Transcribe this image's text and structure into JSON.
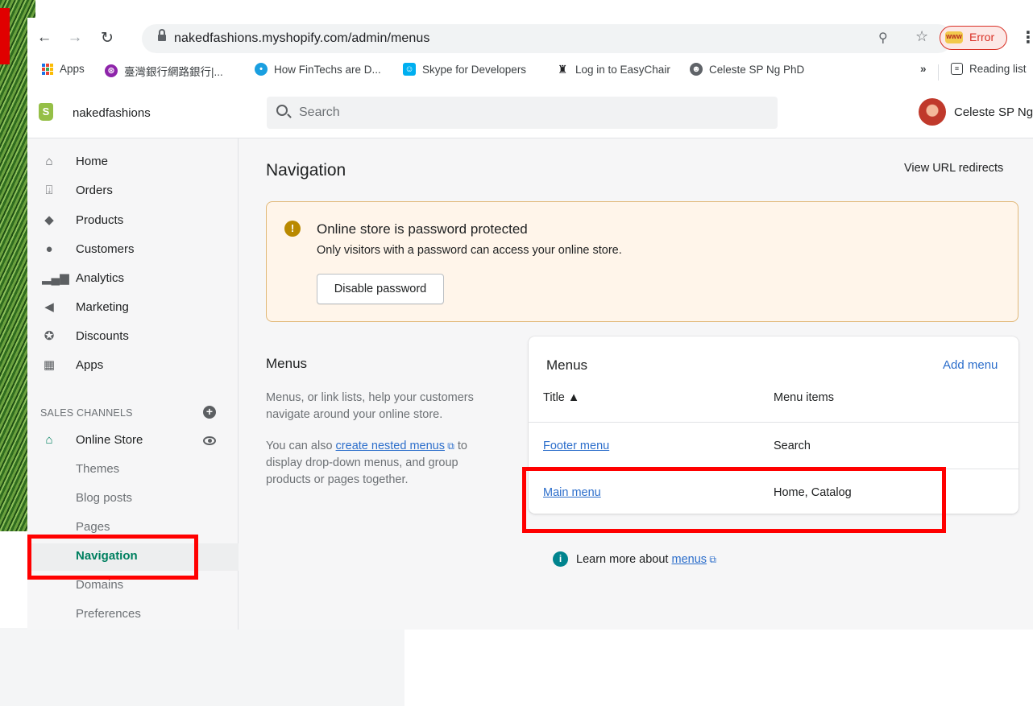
{
  "browser": {
    "url": "nakedfashions.myshopify.com/admin/menus",
    "profile_status": "Error",
    "profile_badge": "WWW",
    "bookmarks": [
      "Apps",
      "臺灣銀行網路銀行|...",
      "How FinTechs are D...",
      "Skype for Developers",
      "Log in to EasyChair",
      "Celeste SP Ng PhD"
    ],
    "more_bookmarks": "»",
    "reading_list": "Reading list"
  },
  "shop": {
    "logo_letter": "S",
    "name": "nakedfashions",
    "search_placeholder": "Search",
    "user": "Celeste SP Ng"
  },
  "sidebar": {
    "items": [
      {
        "label": "Home",
        "icon": "home-icon"
      },
      {
        "label": "Orders",
        "icon": "orders-icon"
      },
      {
        "label": "Products",
        "icon": "tag-icon"
      },
      {
        "label": "Customers",
        "icon": "person-icon"
      },
      {
        "label": "Analytics",
        "icon": "bar-chart-icon"
      },
      {
        "label": "Marketing",
        "icon": "megaphone-icon"
      },
      {
        "label": "Discounts",
        "icon": "discount-icon"
      },
      {
        "label": "Apps",
        "icon": "apps-icon"
      }
    ],
    "sales_channels": "SALES CHANNELS",
    "online_store": "Online Store",
    "sub_items": [
      "Themes",
      "Blog posts",
      "Pages",
      "Navigation",
      "Domains",
      "Preferences"
    ]
  },
  "main": {
    "title": "Navigation",
    "view_redirects": "View URL redirects",
    "banner": {
      "title": "Online store is password protected",
      "body": "Only visitors with a password can access your online store.",
      "button": "Disable password"
    },
    "menus_section": {
      "heading": "Menus",
      "desc1": "Menus, or link lists, help your customers navigate around your online store.",
      "desc2_pre": "You can also ",
      "desc2_link": "create nested menus",
      "desc2_post": " to display drop-down menus, and group products or pages together."
    },
    "card": {
      "title": "Menus",
      "add_menu": "Add menu",
      "col_title": "Title ▲",
      "col_items": "Menu items",
      "rows": [
        {
          "name": "Footer menu",
          "items": "Search"
        },
        {
          "name": "Main menu",
          "items": "Home, Catalog"
        }
      ]
    },
    "learn_pre": "Learn more about ",
    "learn_link": "menus"
  },
  "colors": {
    "accent_green": "#008060",
    "link_blue": "#2c6ecb",
    "highlight_red": "#ff0000",
    "warning": "#b98900"
  }
}
